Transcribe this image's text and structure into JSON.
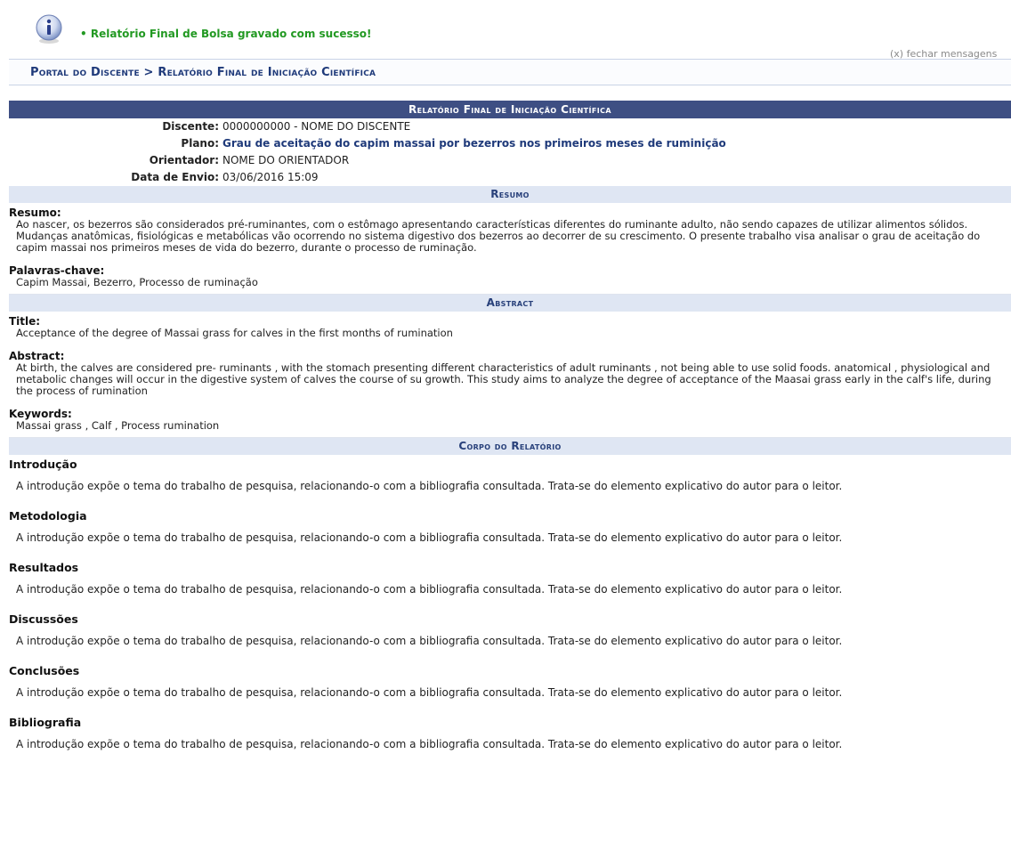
{
  "message": {
    "text": "• Relatório Final de Bolsa gravado com sucesso!",
    "close_label": "(x) fechar mensagens"
  },
  "breadcrumb": "Portal do Discente > Relatório Final de Iniciação Científica",
  "report": {
    "caption": "Relatório Final de Iniciação Científica",
    "info": {
      "discente_label": "Discente:",
      "discente_value": "0000000000 - NOME DO DISCENTE",
      "plano_label": "Plano:",
      "plano_value": "Grau de aceitação do capim massai por bezerros nos primeiros meses de ruminição",
      "orientador_label": "Orientador:",
      "orientador_value": "NOME DO ORIENTADOR",
      "data_label": "Data de Envio:",
      "data_value": "03/06/2016 15:09"
    },
    "resumo_section": {
      "header": "Resumo",
      "resumo_label": "Resumo:",
      "resumo_text": "Ao nascer, os bezerros são considerados pré-ruminantes, com o estômago apresentando características diferentes do ruminante adulto, não sendo capazes de utilizar alimentos sólidos. Mudanças anatômicas, fisiológicas e metabólicas vão ocorrendo no sistema digestivo dos bezerros ao decorrer de su crescimento. O presente trabalho visa analisar o grau de aceitação do capim massai nos primeiros meses de vida do bezerro, durante o processo de ruminação.",
      "palavras_label": "Palavras-chave:",
      "palavras_text": "Capim Massai, Bezerro, Processo de ruminação"
    },
    "abstract_section": {
      "header": "Abstract",
      "title_label": "Title:",
      "title_text": "Acceptance of the degree of Massai grass for calves in the first months of rumination",
      "abstract_label": "Abstract:",
      "abstract_text": "At birth, the calves are considered pre- ruminants , with the stomach presenting different characteristics of adult ruminants , not being able to use solid foods. anatomical , physiological and metabolic changes will occur in the digestive system of calves the course of su growth. This study aims to analyze the degree of acceptance of the Maasai grass early in the calf's life, during the process of rumination",
      "keywords_label": "Keywords:",
      "keywords_text": "Massai grass , Calf , Process rumination"
    },
    "body_section": {
      "header": "Corpo do Relatório",
      "items": [
        {
          "title": "Introdução",
          "text": "A introdução expõe o tema do trabalho de pesquisa, relacionando-o com a bibliografia consultada. Trata-se do elemento explicativo do autor para o leitor."
        },
        {
          "title": "Metodologia",
          "text": "A introdução expõe o tema do trabalho de pesquisa, relacionando-o com a bibliografia consultada. Trata-se do elemento explicativo do autor para o leitor."
        },
        {
          "title": "Resultados",
          "text": "A introdução expõe o tema do trabalho de pesquisa, relacionando-o com a bibliografia consultada. Trata-se do elemento explicativo do autor para o leitor."
        },
        {
          "title": "Discussões",
          "text": "A introdução expõe o tema do trabalho de pesquisa, relacionando-o com a bibliografia consultada. Trata-se do elemento explicativo do autor para o leitor."
        },
        {
          "title": "Conclusões",
          "text": "A introdução expõe o tema do trabalho de pesquisa, relacionando-o com a bibliografia consultada. Trata-se do elemento explicativo do autor para o leitor."
        },
        {
          "title": "Bibliografia",
          "text": "A introdução expõe o tema do trabalho de pesquisa, relacionando-o com a bibliografia consultada. Trata-se do elemento explicativo do autor para o leitor."
        }
      ]
    }
  },
  "colors": {
    "success_text": "#229922",
    "caption_bg": "#3e4f83",
    "subcaption_bg": "#dfe6f3",
    "link_blue": "#1f3a7a"
  },
  "icons": {
    "message_icon": "info-icon"
  }
}
